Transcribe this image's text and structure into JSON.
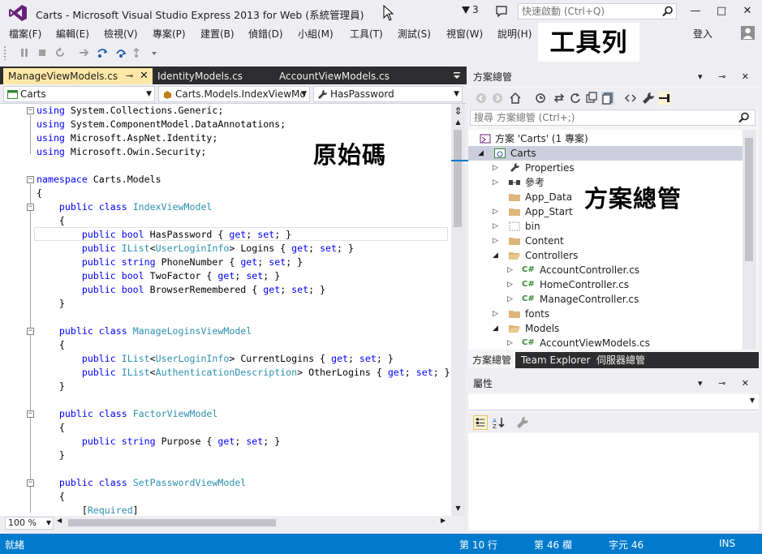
{
  "titlebar": {
    "title": "Carts - Microsoft Visual Studio Express 2013 for Web (系統管理員)",
    "notification_count": "3",
    "quick_launch_placeholder": "快速啟動 (Ctrl+Q)",
    "minimize": "—",
    "maximize": "□",
    "close": "✕"
  },
  "menu": {
    "items": [
      "檔案(F)",
      "編輯(E)",
      "檢視(V)",
      "專案(P)",
      "建置(B)",
      "偵錯(D)",
      "小組(M)",
      "工具(T)",
      "測試(S)",
      "視窗(W)",
      "說明(H)"
    ],
    "login": "登入"
  },
  "annotations": {
    "toolbar": "工具列",
    "source": "原始碼",
    "solution_explorer": "方案總管"
  },
  "editor": {
    "tabs": [
      "ManageViewModels.cs",
      "IdentityModels.cs",
      "AccountViewModels.cs"
    ],
    "nav_project": "Carts",
    "nav_class": "Carts.Models.IndexViewMo",
    "nav_member": "HasPassword",
    "zoom": "100 %",
    "code_lines": [
      "using System.Collections.Generic;",
      "using System.ComponentModel.DataAnnotations;",
      "using Microsoft.AspNet.Identity;",
      "using Microsoft.Owin.Security;",
      "",
      "namespace Carts.Models",
      "{",
      "    public class IndexViewModel",
      "    {",
      "        public bool HasPassword { get; set; }",
      "        public IList<UserLoginInfo> Logins { get; set; }",
      "        public string PhoneNumber { get; set; }",
      "        public bool TwoFactor { get; set; }",
      "        public bool BrowserRemembered { get; set; }",
      "    }",
      "",
      "    public class ManageLoginsViewModel",
      "    {",
      "        public IList<UserLoginInfo> CurrentLogins { get; set; }",
      "        public IList<AuthenticationDescription> OtherLogins { get; set; }",
      "    }",
      "",
      "    public class FactorViewModel",
      "    {",
      "        public string Purpose { get; set; }",
      "    }",
      "",
      "    public class SetPasswordViewModel",
      "    {",
      "        [Required]"
    ]
  },
  "solution_explorer": {
    "title": "方案總管",
    "search_placeholder": "搜尋 方案總管 (Ctrl+;)",
    "tree": [
      {
        "label": "方案 'Carts' (1 專案)",
        "icon": "solution-icon"
      },
      {
        "label": "Carts",
        "icon": "web-project-icon"
      },
      {
        "label": "Properties",
        "icon": "wrench-icon"
      },
      {
        "label": "參考",
        "icon": "references-icon"
      },
      {
        "label": "App_Data",
        "icon": "folder-icon"
      },
      {
        "label": "App_Start",
        "icon": "folder-icon"
      },
      {
        "label": "bin",
        "icon": "dotted-folder-icon"
      },
      {
        "label": "Content",
        "icon": "folder-icon"
      },
      {
        "label": "Controllers",
        "icon": "folder-icon"
      },
      {
        "label": "AccountController.cs",
        "icon": "csharp-file-icon"
      },
      {
        "label": "HomeController.cs",
        "icon": "csharp-file-icon"
      },
      {
        "label": "ManageController.cs",
        "icon": "csharp-file-icon"
      },
      {
        "label": "fonts",
        "icon": "folder-icon"
      },
      {
        "label": "Models",
        "icon": "folder-icon"
      },
      {
        "label": "AccountViewModels.cs",
        "icon": "csharp-file-icon"
      }
    ],
    "bottom_tabs": [
      "方案總管",
      "Team Explorer",
      "伺服器總管"
    ]
  },
  "properties": {
    "title": "屬性"
  },
  "statusbar": {
    "ready": "就緒",
    "line": "第 10 行",
    "column": "第 46 欄",
    "char": "字元 46",
    "mode": "INS"
  },
  "colors": {
    "accent": "#007acc",
    "active_tab": "#ffe8a6",
    "keyword": "#0000ff",
    "type": "#2b91af"
  }
}
